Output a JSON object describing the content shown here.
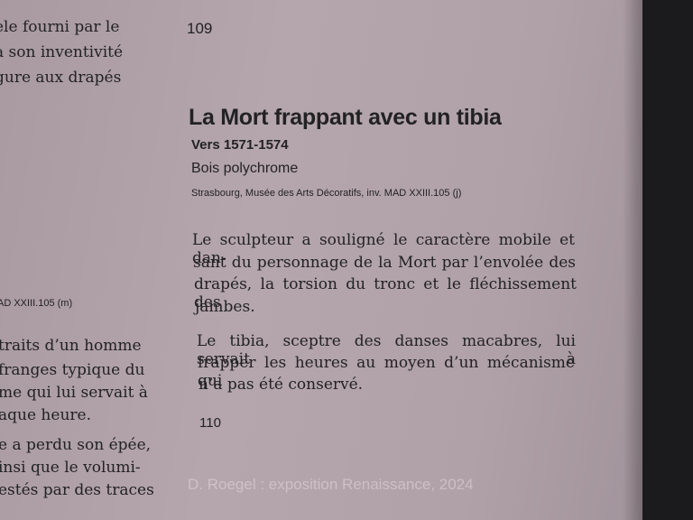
{
  "left_column": {
    "top_lines": [
      "èle fourni par le",
      "à son inventivité",
      "gure aux drapés"
    ],
    "inventory": "AD XXIII.105 (m)",
    "lines_a": [
      "traits d’un homme",
      "franges typique du",
      "me qui lui servait à",
      "aque heure."
    ],
    "lines_b": [
      "e a perdu son épée,",
      "insi que le volumi-",
      "estés par des traces"
    ]
  },
  "entry_109": {
    "number": "109",
    "title": "La Mort frappant avec un tibia",
    "date": "Vers 1571-1574",
    "medium": "Bois polychrome",
    "credit": "Strasbourg, Musée des Arts Décoratifs, inv. MAD XXIII.105 (j)",
    "paragraph1": [
      "Le sculpteur a souligné le caractère mobile et dan-",
      "sant du personnage de la Mort par l’envolée des",
      "drapés, la torsion du tronc et le fléchissement des",
      "jambes."
    ],
    "paragraph2": [
      "Le tibia, sceptre des danses macabres, lui servait à",
      "frapper les heures au moyen d’un mécanisme qui",
      "n’a pas été conservé."
    ]
  },
  "next_entry": {
    "number": "110"
  },
  "watermark": "D. Roegel : exposition Renaissance, 2024"
}
